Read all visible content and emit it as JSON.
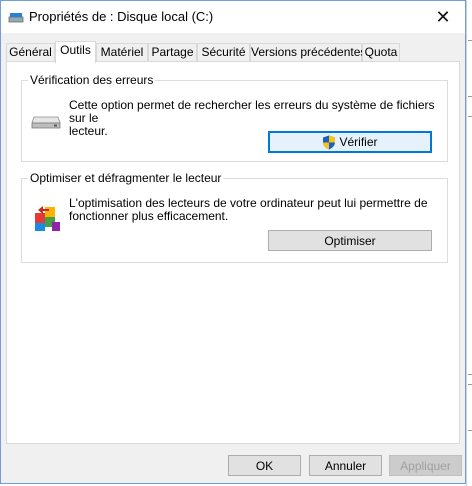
{
  "window": {
    "title": "Propriétés de : Disque local (C:)"
  },
  "tabs": [
    {
      "label": "Général"
    },
    {
      "label": "Outils"
    },
    {
      "label": "Matériel"
    },
    {
      "label": "Partage"
    },
    {
      "label": "Sécurité"
    },
    {
      "label": "Versions précédentes"
    },
    {
      "label": "Quota"
    }
  ],
  "active_tab": "Outils",
  "error_check": {
    "title": "Vérification des erreurs",
    "description_line1": "Cette option permet de rechercher les erreurs du système de fichiers sur le",
    "description_line2": "lecteur.",
    "button_label": "Vérifier",
    "icon": "hard-drive-icon",
    "button_icon": "uac-shield-icon"
  },
  "optimize": {
    "title": "Optimiser et défragmenter le lecteur",
    "description_line1": "L'optimisation des lecteurs de votre ordinateur peut lui permettre de",
    "description_line2": "fonctionner plus efficacement.",
    "button_label": "Optimiser",
    "icon": "defrag-icon"
  },
  "footer": {
    "ok_label": "OK",
    "cancel_label": "Annuler",
    "apply_label": "Appliquer"
  },
  "colors": {
    "focus_border": "#0078d7",
    "window_border": "#6f9fd8"
  }
}
